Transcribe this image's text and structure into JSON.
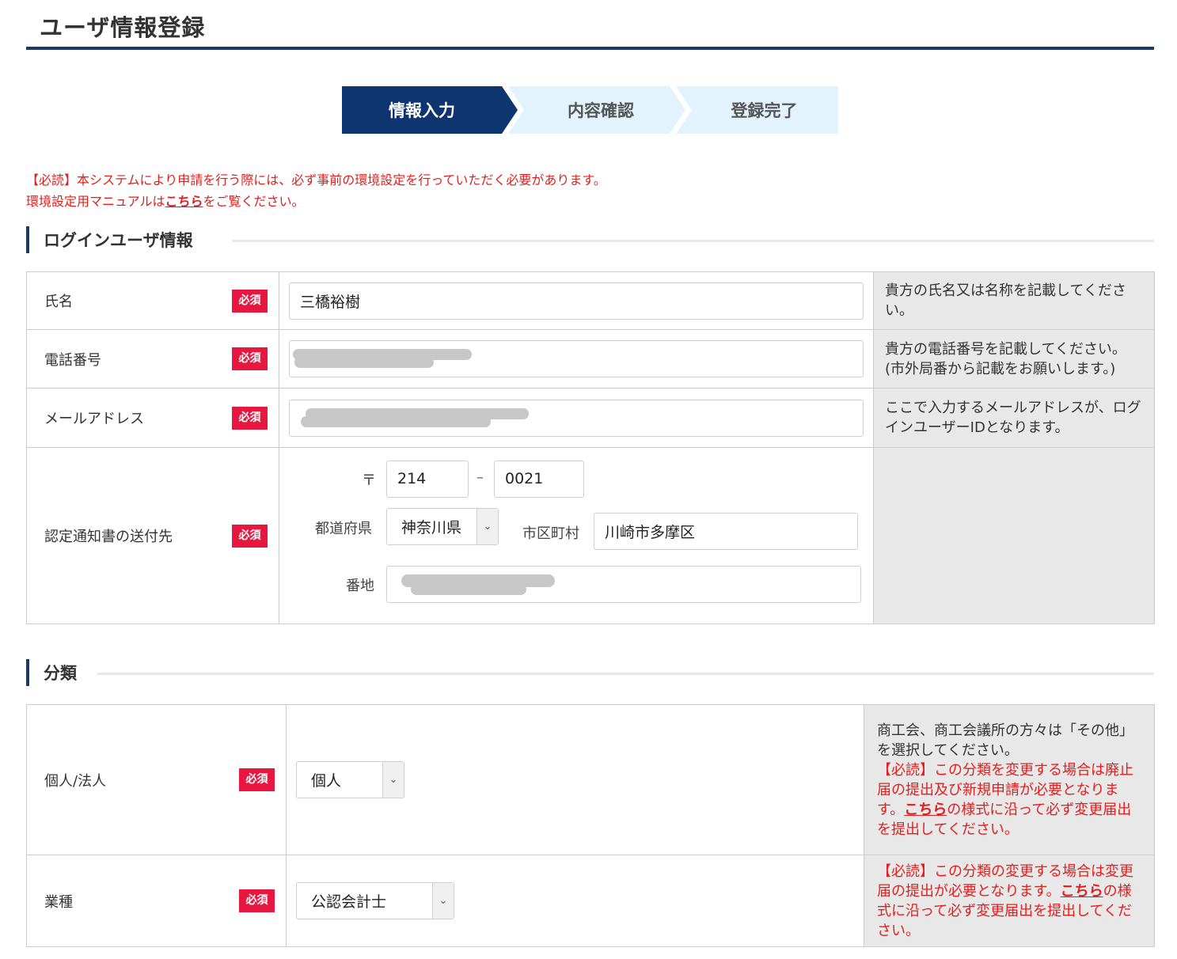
{
  "page": {
    "title": "ユーザ情報登録"
  },
  "steps": [
    {
      "label": "情報入力",
      "state": "current"
    },
    {
      "label": "内容確認",
      "state": "pending"
    },
    {
      "label": "登録完了",
      "state": "pending"
    }
  ],
  "notice": {
    "line1": "【必読】本システムにより申請を行う際には、必ず事前の環境設定を行っていただく必要があります。",
    "line2_prefix": "環境設定用マニュアルは",
    "line2_link": "こちら",
    "line2_suffix": "をご覧ください。"
  },
  "badge_required": "必須",
  "login_section": {
    "heading": "ログインユーザ情報",
    "name": {
      "label": "氏名",
      "value": "三橋裕樹",
      "help": "貴方の氏名又は名称を記載してください。"
    },
    "phone": {
      "label": "電話番号",
      "value": "",
      "help": "貴方の電話番号を記載してください。(市外局番から記載をお願いします。)"
    },
    "email": {
      "label": "メールアドレス",
      "value": "",
      "help": "ここで入力するメールアドレスが、ログインユーザーIDとなります。"
    },
    "address": {
      "label": "認定通知書の送付先",
      "postal_mark": "〒",
      "postal_1": "214",
      "postal_sep": "–",
      "postal_2": "0021",
      "prefecture_label": "都道府県",
      "prefecture_value": "神奈川県",
      "city_label": "市区町村",
      "city_value": "川崎市多摩区",
      "street_label": "番地",
      "street_value": ""
    }
  },
  "category_section": {
    "heading": "分類",
    "type": {
      "label": "個人/法人",
      "value": "個人",
      "help_1": "商工会、商工会議所の方々は「その他」を選択してください。",
      "help_2_prefix": "【必読】この分類を変更する場合は廃止届の提出及び新規申請が必要となります。",
      "help_2_link": "こちら",
      "help_2_suffix": "の様式に沿って必ず変更届出を提出してください。"
    },
    "industry": {
      "label": "業種",
      "value": "公認会計士",
      "help_prefix": "【必読】この分類の変更する場合は変更届の提出が必要となります。",
      "help_link": "こちら",
      "help_suffix": "の様式に沿って必ず変更届出を提出してください。"
    }
  },
  "colors": {
    "navy": "#0f3570",
    "required_red": "#e8173f",
    "notice_red": "#e0201e",
    "step_inactive": "#e3f3fd"
  }
}
